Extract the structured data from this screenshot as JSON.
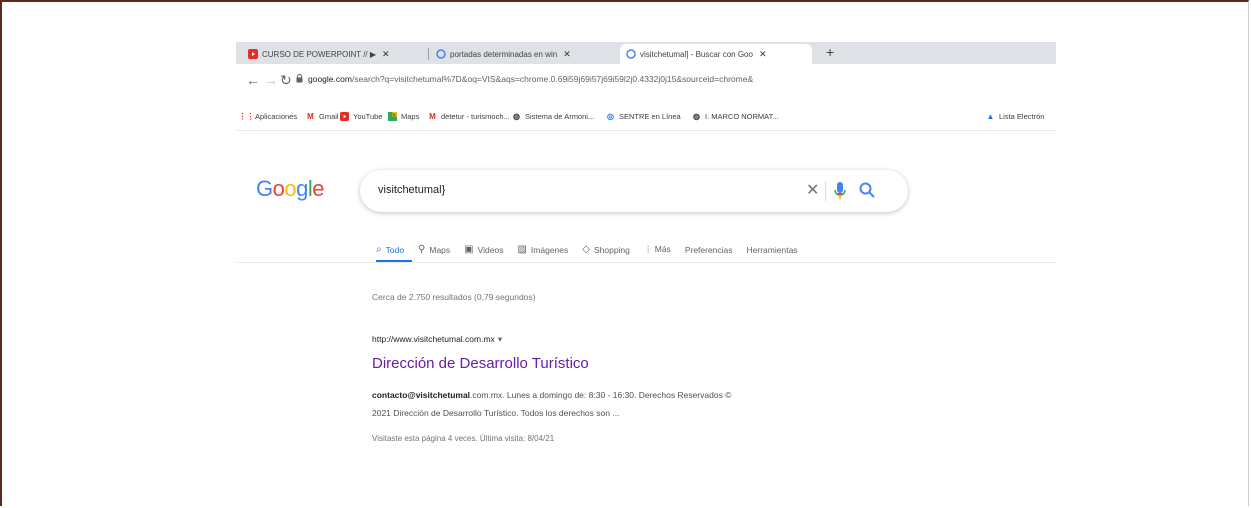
{
  "browser": {
    "tabs": [
      {
        "title": "CURSO DE POWERPOINT // ▶︎",
        "icon": "youtube-icon"
      },
      {
        "title": "portadas determinadas en win",
        "icon": "google-icon"
      },
      {
        "title": "visitchetumal] - Buscar con Goo",
        "icon": "google-icon",
        "active": true
      }
    ],
    "new_tab": "+",
    "url_domain": "google.com",
    "url_rest": "/search?q=visitchetumal%7D&oq=VIS&aqs=chrome.0.69i59j69i57j69i59l2j0.4332j0j15&sourceid=chrome&",
    "bookmarks": [
      {
        "label": "Aplicaciones",
        "icon": "apps-grid-icon"
      },
      {
        "label": "Gmail",
        "icon": "gmail-icon"
      },
      {
        "label": "YouTube",
        "icon": "youtube-icon"
      },
      {
        "label": "Maps",
        "icon": "maps-icon"
      },
      {
        "label": "detetur - turismoch...",
        "icon": "gmail-icon"
      },
      {
        "label": "Sistema de Armoni...",
        "icon": "globe-icon"
      },
      {
        "label": "SENTRE en Línea",
        "icon": "sentre-icon"
      },
      {
        "label": "I. MARCO NORMAT...",
        "icon": "globe-icon"
      },
      {
        "label": "Lista Electrón",
        "icon": "list-icon"
      }
    ]
  },
  "search": {
    "logo": "Google",
    "query": "visitchetumal}",
    "tabs": [
      {
        "label": "Todo",
        "icon": "search-icon",
        "active": true
      },
      {
        "label": "Maps",
        "icon": "pin-icon"
      },
      {
        "label": "Videos",
        "icon": "video-icon"
      },
      {
        "label": "Imágenes",
        "icon": "image-icon"
      },
      {
        "label": "Shopping",
        "icon": "tag-icon"
      },
      {
        "label": "⋮ Más",
        "icon": ""
      },
      {
        "label": "Preferencias",
        "icon": ""
      },
      {
        "label": "Herramientas",
        "icon": ""
      }
    ],
    "stats": "Cerca de 2.750 resultados (0,79 segundos)"
  },
  "result": {
    "cite": "http://www.visitchetumal.com.mx",
    "title": "Dirección de Desarrollo Turístico",
    "snippet_bold": "contacto@visitchetumal",
    "snippet_line1_rest": ".com.mx. Lunes a domingo de: 8:30 - 16:30. Derechos Reservados ©",
    "snippet_line2": "2021 Dirección de Desarrollo Turístico. Todos los derechos son ...",
    "visited": "Visitaste esta página 4 veces. Última visita: 8/04/21"
  },
  "colors": {
    "link_visited": "#681da8",
    "accent_blue": "#1a73e8",
    "frame_border": "#5a2a1e"
  }
}
